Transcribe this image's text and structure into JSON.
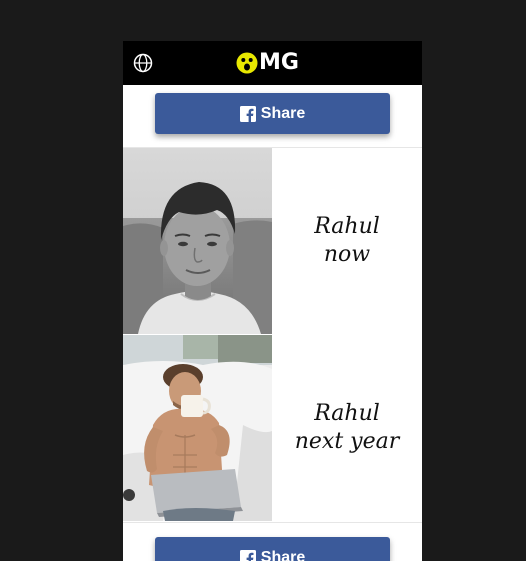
{
  "header": {
    "logo_text": "MG",
    "globe_icon": "globe-icon",
    "logo_icon": "surprised-face-icon"
  },
  "share_top": {
    "label": "Share",
    "icon": "facebook-icon",
    "color": "#3b5a9a"
  },
  "meme": {
    "top": {
      "line1": "Rahul",
      "line2": "now"
    },
    "bottom": {
      "line1": "Rahul",
      "line2": "next year"
    }
  },
  "share_bottom": {
    "label": "Share",
    "icon": "facebook-icon"
  },
  "colors": {
    "page_bg": "#1a1a1a",
    "topbar_bg": "#000000",
    "logo_accent": "#e8e800"
  }
}
